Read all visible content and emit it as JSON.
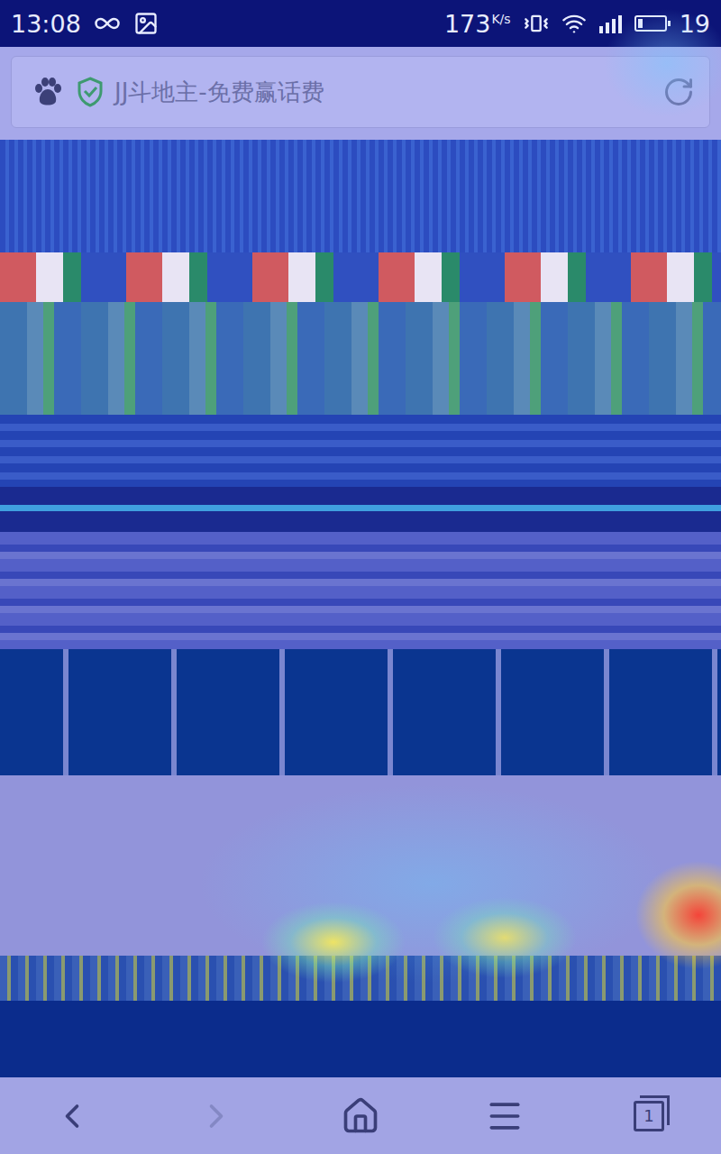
{
  "status_bar": {
    "time": "13:08",
    "speed": "173",
    "speed_unit": "K/s",
    "battery": "19"
  },
  "address_bar": {
    "title": "JJ斗地主-免费赢话费"
  },
  "toolbar": {
    "tab_count": "1"
  }
}
